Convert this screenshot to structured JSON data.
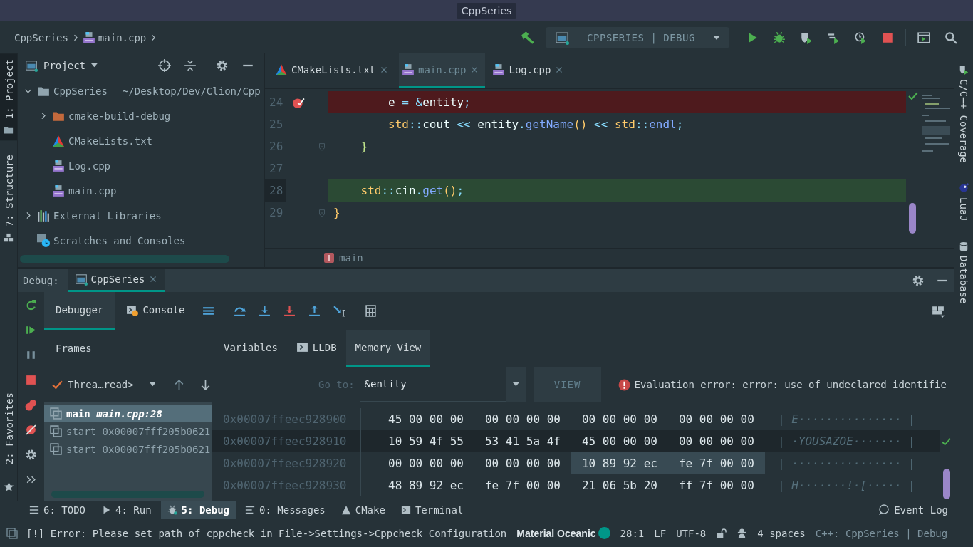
{
  "window": {
    "title": "CppSeries"
  },
  "breadcrumb": [
    {
      "label": "CppSeries",
      "kind": "project"
    },
    {
      "label": "main.cpp",
      "kind": "cpp"
    }
  ],
  "run_config": {
    "label": "CPPSERIES | DEBUG"
  },
  "left_strip": [
    {
      "label": "1: Project",
      "kind": "project",
      "selected": true
    },
    {
      "label": "7: Structure",
      "kind": "structure",
      "selected": false
    }
  ],
  "left_strip_bottom": [
    {
      "label": "2: Favorites",
      "selected": false
    }
  ],
  "right_strip": [
    {
      "label": "C/C++ Coverage",
      "kind": "coverage"
    },
    {
      "label": "LuaJ",
      "kind": "lua"
    },
    {
      "label": "Database",
      "kind": "database"
    }
  ],
  "project": {
    "title": "Project",
    "tree": [
      {
        "label": "CppSeries",
        "path": "~/Desktop/Dev/Clion/Cpp",
        "kind": "folder",
        "expanded": true,
        "children": [
          {
            "label": "cmake-build-debug",
            "kind": "build",
            "expanded": false
          },
          {
            "label": "CMakeLists.txt",
            "kind": "cmake"
          },
          {
            "label": "Log.cpp",
            "kind": "cpp"
          },
          {
            "label": "main.cpp",
            "kind": "cpp"
          }
        ]
      },
      {
        "label": "External Libraries",
        "kind": "libraries",
        "expanded": false
      },
      {
        "label": "Scratches and Consoles",
        "kind": "scratches"
      }
    ]
  },
  "editor_tabs": [
    {
      "label": "CMakeLists.txt",
      "kind": "cmake",
      "selected": false
    },
    {
      "label": "main.cpp",
      "kind": "cpp",
      "selected": true
    },
    {
      "label": "Log.cpp",
      "kind": "cpp",
      "selected": false
    }
  ],
  "code_lines": [
    {
      "number": "24",
      "kind": "error",
      "breakpoint": true,
      "fold": false,
      "tokens": [
        {
          "text": "        e ",
          "kind": "plain"
        },
        {
          "text": "= &",
          "kind": "op"
        },
        {
          "text": "entity",
          "kind": "plain"
        },
        {
          "text": ";",
          "kind": "op"
        }
      ]
    },
    {
      "number": "25",
      "kind": "plain",
      "breakpoint": false,
      "fold": false,
      "tokens": [
        {
          "text": "        std",
          "kind": "type"
        },
        {
          "text": "::",
          "kind": "op"
        },
        {
          "text": "cout ",
          "kind": "plain"
        },
        {
          "text": "<< ",
          "kind": "op"
        },
        {
          "text": "entity",
          "kind": "plain"
        },
        {
          "text": ".",
          "kind": "op"
        },
        {
          "text": "getName",
          "kind": "func"
        },
        {
          "text": "()",
          "kind": "paren"
        },
        {
          "text": " << ",
          "kind": "op"
        },
        {
          "text": "std",
          "kind": "type"
        },
        {
          "text": "::",
          "kind": "op"
        },
        {
          "text": "endl",
          "kind": "func"
        },
        {
          "text": ";",
          "kind": "op"
        }
      ]
    },
    {
      "number": "26",
      "kind": "plain",
      "breakpoint": false,
      "fold": true,
      "tokens": [
        {
          "text": "    }",
          "kind": "inner"
        }
      ]
    },
    {
      "number": "27",
      "kind": "plain",
      "breakpoint": false,
      "fold": false
    },
    {
      "number": "28",
      "kind": "current",
      "breakpoint": false,
      "fold": false,
      "tokens": [
        {
          "text": "    std",
          "kind": "type"
        },
        {
          "text": "::",
          "kind": "op"
        },
        {
          "text": "cin",
          "kind": "plain"
        },
        {
          "text": ".",
          "kind": "op"
        },
        {
          "text": "get",
          "kind": "func"
        },
        {
          "text": "()",
          "kind": "paren"
        },
        {
          "text": ";",
          "kind": "op"
        }
      ]
    },
    {
      "number": "29",
      "kind": "plain",
      "breakpoint": false,
      "fold": true,
      "tokens": [
        {
          "text": "}",
          "kind": "outer"
        }
      ]
    }
  ],
  "editor_breadcrumb": {
    "label": "main"
  },
  "debug": {
    "label": "Debug:",
    "session_tabs": [
      {
        "label": "CppSeries",
        "selected": true
      }
    ],
    "view_tabs": [
      {
        "label": "Debugger",
        "kind": "debugger",
        "selected": true
      },
      {
        "label": "Console",
        "kind": "console",
        "selected": false
      }
    ],
    "frames_title": "Frames",
    "panel_tabs": [
      {
        "label": "Variables",
        "kind": "variables",
        "selected": false
      },
      {
        "label": "LLDB",
        "kind": "lldb",
        "selected": false
      },
      {
        "label": "Memory View",
        "kind": "memory",
        "selected": true
      }
    ],
    "thread": "Threa…read>",
    "frames": [
      {
        "text": "main *main.cpp:28*",
        "selected": true
      },
      {
        "text": "start 0x00007fff205b0621",
        "selected": false
      },
      {
        "text": "start 0x00007fff205b0621",
        "selected": false
      }
    ]
  },
  "memory": {
    "goto_label": "Go to:",
    "goto_value": "&entity",
    "view_button": "VIEW",
    "error": "Evaluation error: error: use of undeclared identifie",
    "rows": [
      {
        "address": "0x00007ffeec928900",
        "selected": false,
        "groups": [
          {
            "bytes": "45 00 00 00",
            "selected": false
          },
          {
            "bytes": "00 00 00 00",
            "selected": false
          },
          {
            "bytes": "00 00 00 00",
            "selected": false
          },
          {
            "bytes": "00 00 00 00",
            "selected": false
          }
        ],
        "ascii": "| E··············· |"
      },
      {
        "address": "0x00007ffeec928910",
        "selected": true,
        "groups": [
          {
            "bytes": "10 59 4f 55",
            "selected": false
          },
          {
            "bytes": "53 41 5a 4f",
            "selected": false
          },
          {
            "bytes": "45 00 00 00",
            "selected": false
          },
          {
            "bytes": "00 00 00 00",
            "selected": false
          }
        ],
        "ascii": "| ·YOUSAZOE······· |"
      },
      {
        "address": "0x00007ffeec928920",
        "selected": false,
        "groups": [
          {
            "bytes": "00 00 00 00",
            "selected": false
          },
          {
            "bytes": "00 00 00 00",
            "selected": false
          },
          {
            "bytes": "10 89 92 ec",
            "selected": true
          },
          {
            "bytes": "fe 7f 00 00",
            "selected": true
          }
        ],
        "ascii": "| ················ |"
      },
      {
        "address": "0x00007ffeec928930",
        "selected": false,
        "groups": [
          {
            "bytes": "48 89 92 ec",
            "selected": false
          },
          {
            "bytes": "fe 7f 00 00",
            "selected": false
          },
          {
            "bytes": "21 06 5b 20",
            "selected": false
          },
          {
            "bytes": "ff 7f 00 00",
            "selected": false
          }
        ],
        "ascii": "| H·······!·[····· |"
      }
    ]
  },
  "tool_windows": [
    {
      "label": "6: TODO",
      "kind": "todo",
      "selected": false
    },
    {
      "label": "4: Run",
      "kind": "run",
      "selected": false
    },
    {
      "label": "5: Debug",
      "kind": "debug",
      "selected": true
    },
    {
      "label": "0: Messages",
      "kind": "messages",
      "selected": false
    },
    {
      "label": "CMake",
      "kind": "cmake",
      "selected": false
    },
    {
      "label": "Terminal",
      "kind": "terminal",
      "selected": false
    }
  ],
  "event_log": {
    "label": "Event Log"
  },
  "status_bar": {
    "message": "[!] Error: Please set path of cppcheck in File->Settings->Cppcheck Configuration",
    "theme": "Material Oceanic",
    "position": "28:1",
    "line_separator": "LF",
    "encoding": "UTF-8",
    "indent": "4 spaces",
    "context": "C++: CppSeries | Debug"
  }
}
